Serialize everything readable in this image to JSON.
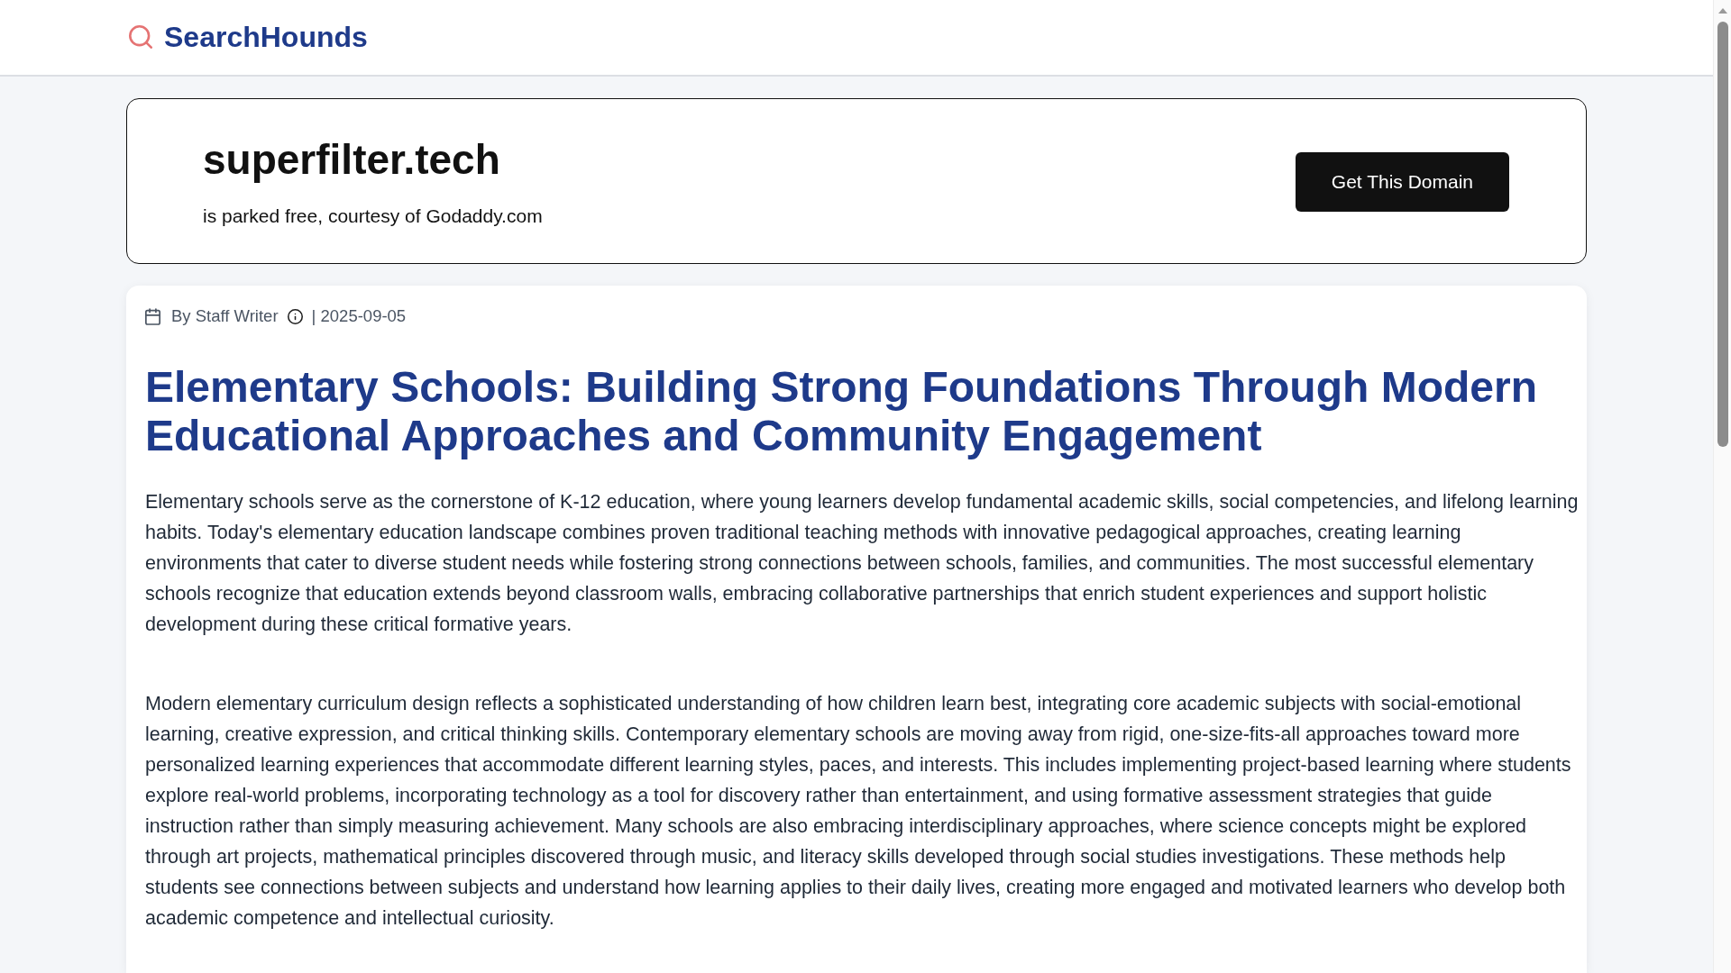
{
  "header": {
    "logo_text": "SearchHounds"
  },
  "domain_banner": {
    "domain": "superfilter.tech",
    "subtitle": "is parked free, courtesy of Godaddy.com",
    "button": "Get This Domain"
  },
  "article": {
    "byline": {
      "author": "By Staff Writer",
      "date": "| 2025-09-05"
    },
    "title": "Elementary Schools: Building Strong Foundations Through Modern Educational Approaches and Community Engagement",
    "paragraphs": [
      "Elementary schools serve as the cornerstone of K-12 education, where young learners develop fundamental academic skills, social competencies, and lifelong learning habits. Today's elementary education landscape combines proven traditional teaching methods with innovative pedagogical approaches, creating learning environments that cater to diverse student needs while fostering strong connections between schools, families, and communities. The most successful elementary schools recognize that education extends beyond classroom walls, embracing collaborative partnerships that enrich student experiences and support holistic development during these critical formative years.",
      "Modern elementary curriculum design reflects a sophisticated understanding of how children learn best, integrating core academic subjects with social-emotional learning, creative expression, and critical thinking skills. Contemporary elementary schools are moving away from rigid, one-size-fits-all approaches toward more personalized learning experiences that accommodate different learning styles, paces, and interests. This includes implementing project-based learning where students explore real-world problems, incorporating technology as a tool for discovery rather than entertainment, and using formative assessment strategies that guide instruction rather than simply measuring achievement. Many schools are also embracing interdisciplinary approaches, where science concepts might be explored through art projects, mathematical principles discovered through music, and literacy skills developed through social studies investigations. These methods help students see connections between subjects and understand how learning applies to their daily lives, creating more engaged and motivated learners who develop both academic competence and intellectual curiosity."
    ]
  }
}
